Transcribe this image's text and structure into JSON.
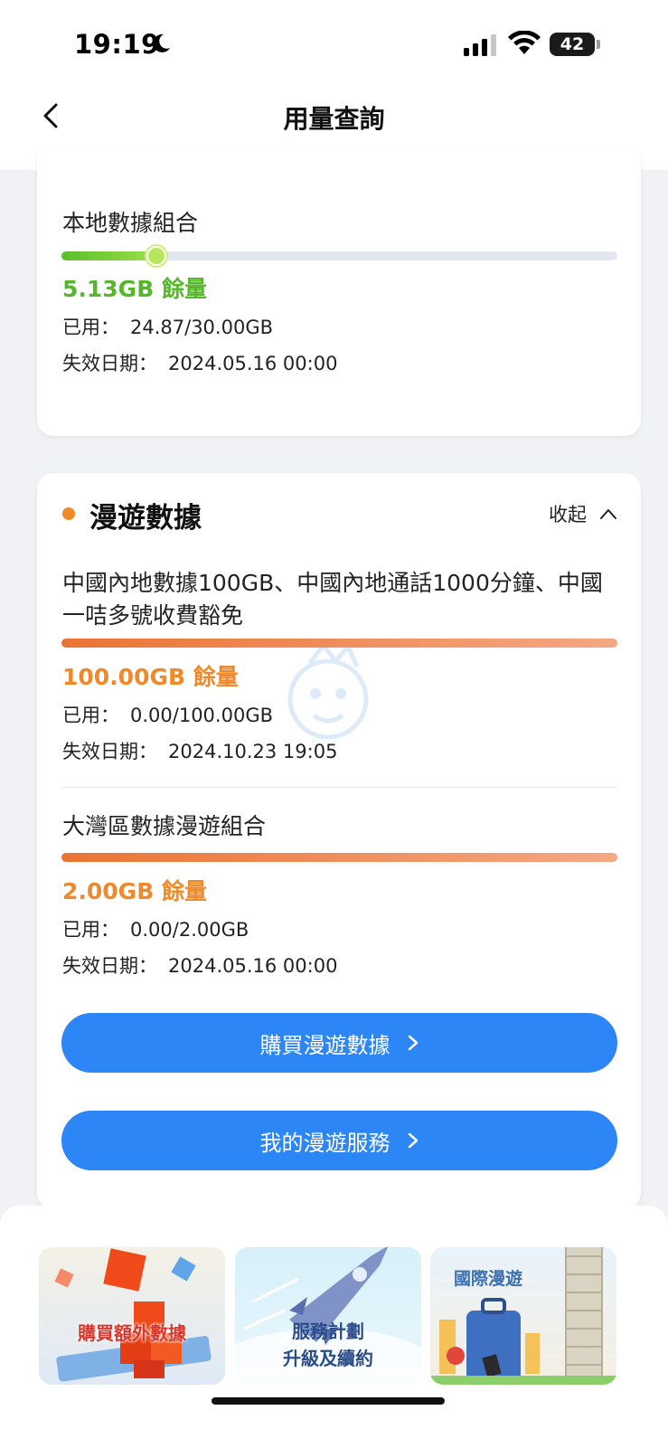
{
  "status_bar": {
    "time": "19:19",
    "battery": "42",
    "icons": [
      "moon-icon",
      "signal-icon",
      "wifi-icon",
      "battery-icon"
    ]
  },
  "nav": {
    "title": "用量查詢",
    "back_icon": "chevron-left-icon"
  },
  "local_plan": {
    "name": "本地數據組合",
    "remaining": "5.13GB 餘量",
    "remaining_fraction": 0.171,
    "used_label": "已用：",
    "used_value": "24.87/30.00GB",
    "expiry_label": "失效日期：",
    "expiry_value": "2024.05.16 00:00",
    "accent": "#56b62c"
  },
  "roaming": {
    "title": "漫遊數據",
    "collapse_label": "收起",
    "accent": "#f08a24",
    "plans": [
      {
        "name": "中國內地數據100GB、中國內地通話1000分鐘、中國一咭多號收費豁免",
        "remaining": "100.00GB 餘量",
        "remaining_fraction": 1.0,
        "used_label": "已用：",
        "used_value": "0.00/100.00GB",
        "expiry_label": "失效日期：",
        "expiry_value": "2024.10.23 19:05"
      },
      {
        "name": "大灣區數據漫遊組合",
        "remaining": "2.00GB 餘量",
        "remaining_fraction": 1.0,
        "used_label": "已用：",
        "used_value": "0.00/2.00GB",
        "expiry_label": "失效日期：",
        "expiry_value": "2024.05.16 00:00"
      }
    ],
    "buttons": {
      "buy": "購買漫遊數據",
      "my_services": "我的漫遊服務"
    },
    "button_color": "#2c86f5"
  },
  "promos": [
    {
      "label": "購買額外數據"
    },
    {
      "label_line1": "服務計劃",
      "label_line2": "升級及續約"
    },
    {
      "label": "國際漫遊"
    }
  ]
}
